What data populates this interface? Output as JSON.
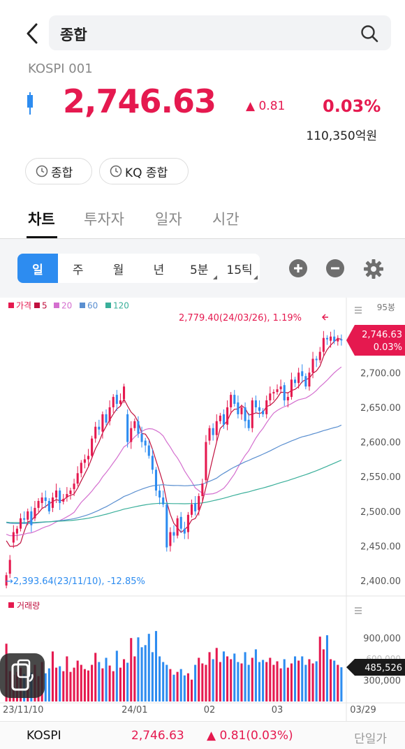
{
  "search": {
    "query": "종합"
  },
  "index": {
    "code": "KOSPI 001",
    "price": "2,746.63",
    "change": "▲ 0.81",
    "change_pct": "0.03%",
    "volume": "110,350억원"
  },
  "chips": [
    {
      "label": "종합"
    },
    {
      "label": "KQ 종합"
    }
  ],
  "tabs": [
    "차트",
    "투자자",
    "일자",
    "시간"
  ],
  "periods": [
    "일",
    "주",
    "월",
    "년",
    "5분",
    "15틱"
  ],
  "legend": {
    "price": "가격",
    "ma": [
      "5",
      "20",
      "60",
      "120"
    ],
    "volume": "거래량"
  },
  "colors": {
    "up": "#e5194f",
    "down": "#2d8cf0",
    "ma5": "#c0103e",
    "ma20": "#d46fcf",
    "ma60": "#5a8fd0",
    "ma120": "#3aaf9a",
    "accent": "#2d8cf0"
  },
  "chart_labels": {
    "candle_count": "95봉",
    "high_note": "2,779.40(24/03/26), 1.19%",
    "low_note": "2,393.64(23/11/10), -12.85%",
    "current_price": "2,746.63",
    "current_pct": "0.03%",
    "current_volume": "485,526",
    "ghost_volume": "600,000"
  },
  "chart_data": {
    "type": "candlestick",
    "title": "",
    "price_axis_ticks": [
      "2,700.00",
      "2,650.00",
      "2,600.00",
      "2,550.00",
      "2,500.00",
      "2,450.00",
      "2,400.00"
    ],
    "price_tick_values": [
      2700,
      2650,
      2600,
      2550,
      2500,
      2450,
      2400
    ],
    "price_range": [
      2385,
      2790
    ],
    "volume_axis_ticks": [
      "900,000",
      "300,000"
    ],
    "volume_tick_values": [
      900000,
      300000
    ],
    "volume_range": [
      0,
      1150000
    ],
    "x_ticks": [
      "23/11/10",
      "24/01",
      "02",
      "03",
      "03/29"
    ],
    "x_tick_index": [
      0,
      36,
      57,
      76,
      96
    ],
    "high": {
      "value": 2779.4,
      "date": "24/03/26",
      "pct": 1.19
    },
    "low": {
      "value": 2393.64,
      "date": "23/11/10",
      "pct": -12.85
    },
    "current_price": 2746.63,
    "current_volume": 485526,
    "close": [
      2408,
      2430,
      2470,
      2475,
      2490,
      2488,
      2500,
      2480,
      2505,
      2515,
      2520,
      2515,
      2500,
      2520,
      2530,
      2512,
      2518,
      2525,
      2530,
      2540,
      2555,
      2570,
      2575,
      2580,
      2605,
      2622,
      2618,
      2640,
      2628,
      2650,
      2665,
      2655,
      2660,
      2680,
      2600,
      2620,
      2630,
      2612,
      2600,
      2595,
      2580,
      2560,
      2530,
      2520,
      2510,
      2448,
      2470,
      2465,
      2490,
      2475,
      2468,
      2495,
      2510,
      2500,
      2522,
      2540,
      2600,
      2620,
      2610,
      2630,
      2638,
      2625,
      2650,
      2668,
      2655,
      2640,
      2650,
      2630,
      2620,
      2660,
      2650,
      2645,
      2640,
      2660,
      2670,
      2672,
      2676,
      2680,
      2660,
      2665,
      2690,
      2685,
      2700,
      2695,
      2680,
      2700,
      2720,
      2718,
      2730,
      2750,
      2748,
      2752,
      2745,
      2750,
      2747
    ],
    "open": [
      2393,
      2410,
      2455,
      2468,
      2475,
      2490,
      2488,
      2500,
      2490,
      2505,
      2512,
      2520,
      2515,
      2505,
      2520,
      2530,
      2514,
      2520,
      2525,
      2532,
      2540,
      2555,
      2570,
      2575,
      2580,
      2605,
      2622,
      2615,
      2640,
      2630,
      2650,
      2668,
      2655,
      2662,
      2640,
      2600,
      2620,
      2630,
      2612,
      2602,
      2595,
      2580,
      2560,
      2530,
      2520,
      2510,
      2450,
      2470,
      2465,
      2492,
      2475,
      2470,
      2495,
      2512,
      2502,
      2522,
      2545,
      2602,
      2620,
      2610,
      2630,
      2640,
      2625,
      2650,
      2668,
      2657,
      2640,
      2650,
      2632,
      2620,
      2660,
      2650,
      2645,
      2640,
      2660,
      2670,
      2672,
      2676,
      2682,
      2660,
      2665,
      2690,
      2685,
      2702,
      2695,
      2680,
      2700,
      2720,
      2718,
      2730,
      2750,
      2746,
      2752,
      2745,
      2748
    ],
    "volume": [
      820000,
      430000,
      380000,
      420000,
      480000,
      390000,
      460000,
      410000,
      520000,
      360000,
      560000,
      400000,
      470000,
      710000,
      480000,
      500000,
      430000,
      640000,
      420000,
      480000,
      580000,
      520000,
      460000,
      440000,
      520000,
      690000,
      560000,
      470000,
      620000,
      510000,
      430000,
      720000,
      480000,
      600000,
      550000,
      900000,
      640000,
      910000,
      770000,
      800000,
      960000,
      700000,
      1000000,
      640000,
      560000,
      520000,
      460000,
      380000,
      420000,
      460000,
      370000,
      400000,
      310000,
      520000,
      620000,
      540000,
      520000,
      700000,
      600000,
      760000,
      560000,
      710000,
      640000,
      600000,
      680000,
      560000,
      540000,
      700000,
      520000,
      620000,
      740000,
      560000,
      590000,
      560000,
      620000,
      520000,
      570000,
      470000,
      600000,
      480000,
      540000,
      640000,
      580000,
      640000,
      520000,
      600000,
      540000,
      570000,
      920000,
      740000,
      940000,
      600000,
      580000,
      520000,
      485526
    ]
  }
}
